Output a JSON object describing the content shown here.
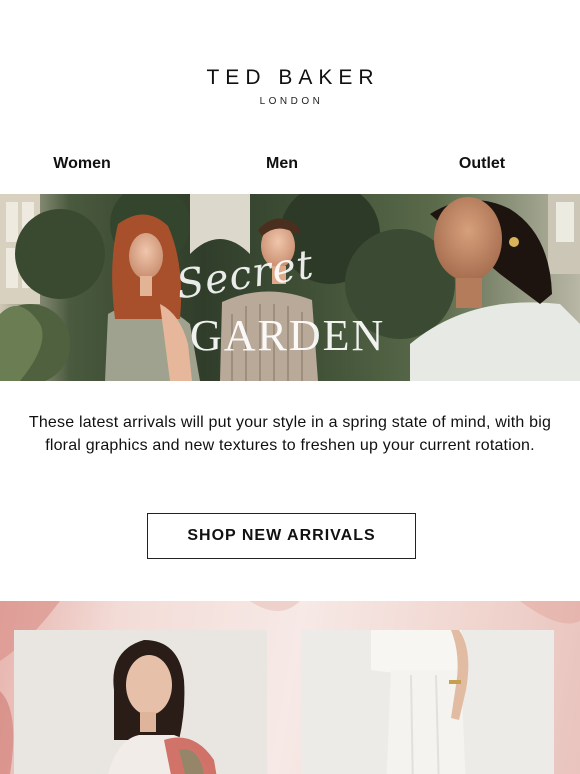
{
  "brand": {
    "name": "TED BAKER",
    "subtitle": "LONDON"
  },
  "nav": {
    "items": [
      {
        "label": "Women"
      },
      {
        "label": "Men"
      },
      {
        "label": "Outlet"
      }
    ]
  },
  "hero": {
    "title_script": "Secret",
    "title_main": "GARDEN"
  },
  "body": {
    "copy": "These latest arrivals will put your style in a spring state of mind, with big floral graphics and new textures to freshen up your current rotation."
  },
  "cta": {
    "label": "SHOP NEW ARRIVALS"
  },
  "colors": {
    "text": "#111111",
    "background": "#ffffff",
    "hero_foliage": "#3d4a35",
    "pink_floral": "#f2d8d2"
  }
}
